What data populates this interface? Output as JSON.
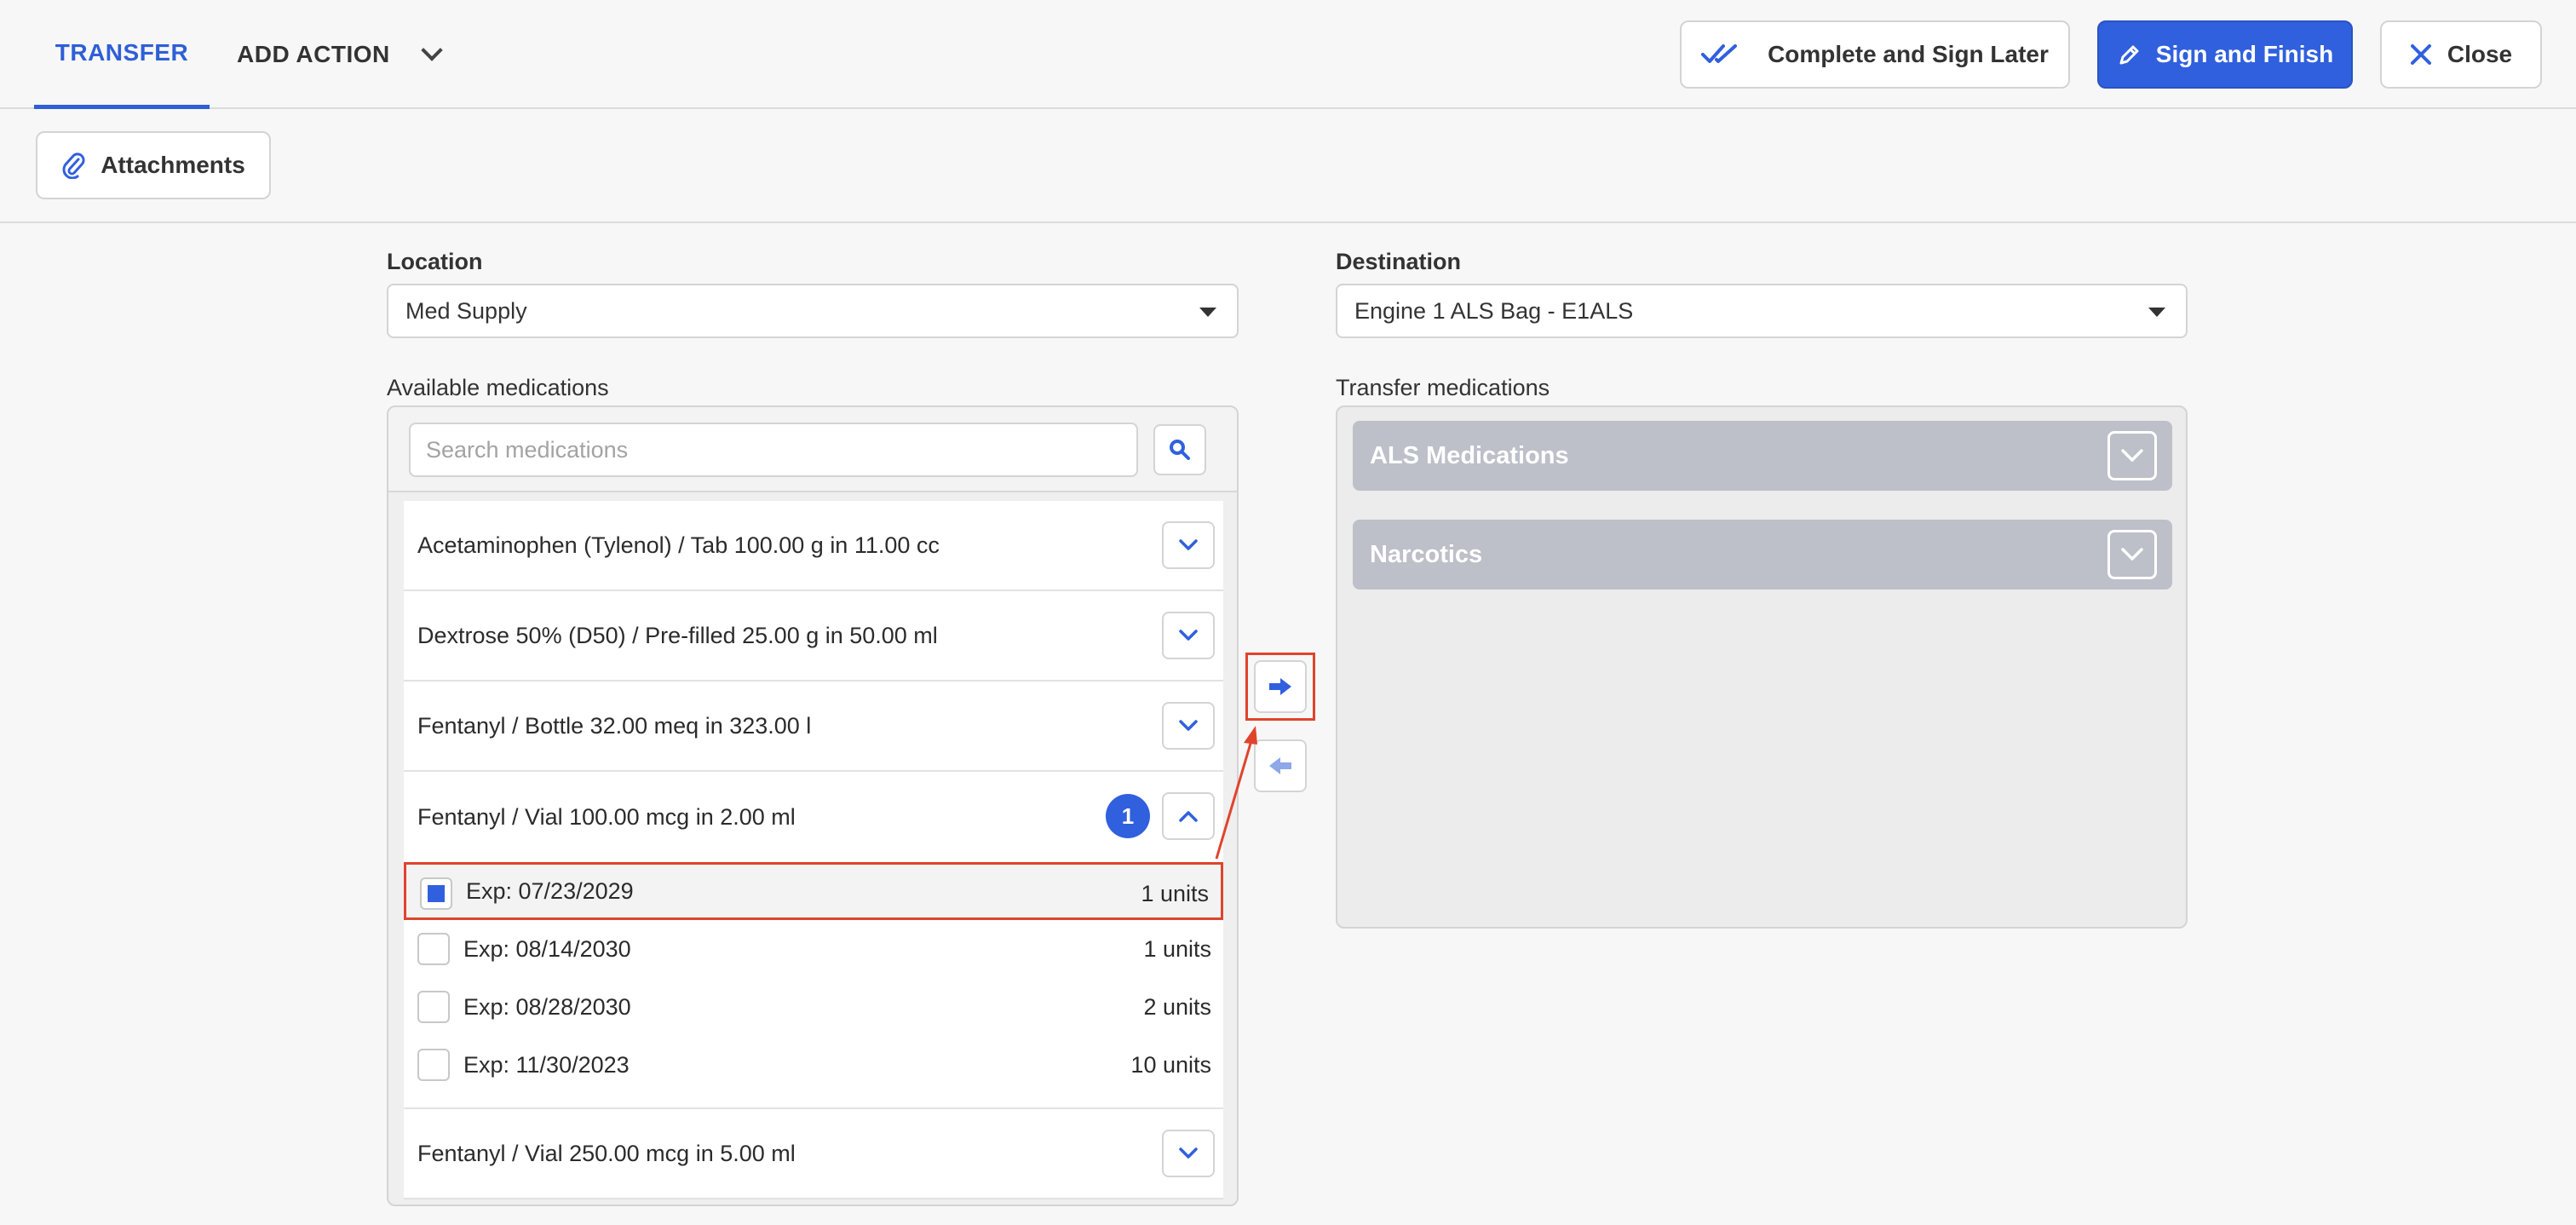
{
  "header": {
    "tabs": [
      {
        "label": "TRANSFER",
        "active": true
      },
      {
        "label": "ADD ACTION",
        "active": false
      }
    ],
    "buttons": {
      "complete_later": "Complete and Sign Later",
      "sign_finish": "Sign and Finish",
      "close": "Close"
    }
  },
  "toolbar": {
    "attachments": "Attachments"
  },
  "location": {
    "label": "Location",
    "value": "Med Supply"
  },
  "destination": {
    "label": "Destination",
    "value": "Engine 1 ALS Bag - E1ALS"
  },
  "available": {
    "label": "Available medications",
    "search_placeholder": "Search medications",
    "items": [
      {
        "name": "Acetaminophen (Tylenol) / Tab 100.00 g in 11.00 cc"
      },
      {
        "name": "Dextrose 50% (D50) / Pre-filled 25.00 g in 50.00 ml"
      },
      {
        "name": "Fentanyl / Bottle 32.00 meq in 323.00 l"
      },
      {
        "name": "Fentanyl / Vial 100.00 mcg in 2.00 ml",
        "badge": "1",
        "expanded": true,
        "lots": [
          {
            "exp": "Exp: 07/23/2029",
            "units": "1 units",
            "checked": true
          },
          {
            "exp": "Exp: 08/14/2030",
            "units": "1 units",
            "checked": false
          },
          {
            "exp": "Exp: 08/28/2030",
            "units": "2 units",
            "checked": false
          },
          {
            "exp": "Exp: 11/30/2023",
            "units": "10 units",
            "checked": false
          }
        ]
      },
      {
        "name": "Fentanyl / Vial 250.00 mcg in 5.00 ml"
      }
    ]
  },
  "transfer": {
    "label": "Transfer medications",
    "groups": [
      {
        "name": "ALS Medications"
      },
      {
        "name": "Narcotics"
      }
    ]
  },
  "colors": {
    "accent": "#3060dd",
    "highlight": "#e0442c",
    "group_bg": "#bdbfc9"
  }
}
